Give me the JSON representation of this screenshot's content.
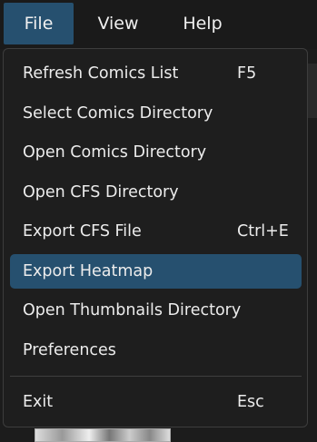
{
  "menubar": {
    "items": [
      {
        "label": "File"
      },
      {
        "label": "View"
      },
      {
        "label": "Help"
      }
    ]
  },
  "file_menu": {
    "items": [
      {
        "label": "Refresh Comics List",
        "shortcut": "F5"
      },
      {
        "label": "Select Comics Directory",
        "shortcut": ""
      },
      {
        "label": "Open Comics Directory",
        "shortcut": ""
      },
      {
        "label": "Open CFS Directory",
        "shortcut": ""
      },
      {
        "label": "Export CFS File",
        "shortcut": "Ctrl+E"
      },
      {
        "label": "Export Heatmap",
        "shortcut": ""
      },
      {
        "label": "Open Thumbnails Directory",
        "shortcut": ""
      },
      {
        "label": "Preferences",
        "shortcut": ""
      },
      {
        "label": "Exit",
        "shortcut": "Esc"
      }
    ],
    "highlighted_item": "Export Heatmap"
  },
  "colors": {
    "accent": "#26506f",
    "menu_background": "#1e1e1e",
    "text": "#ececec"
  }
}
